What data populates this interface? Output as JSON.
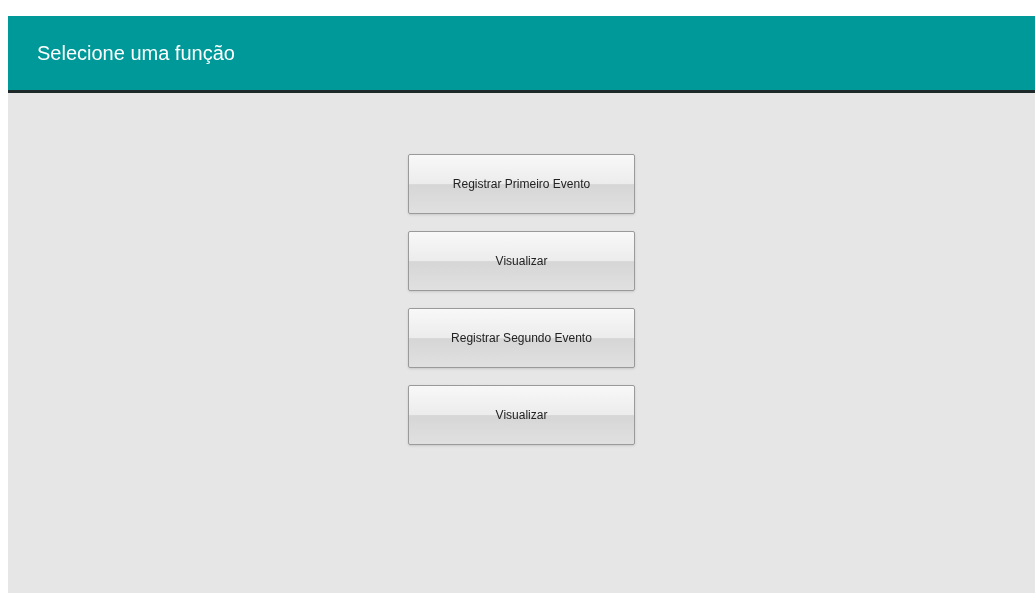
{
  "header": {
    "title": "Selecione uma função"
  },
  "buttons": [
    {
      "label": "Registrar Primeiro Evento"
    },
    {
      "label": "Visualizar"
    },
    {
      "label": "Registrar Segundo Evento"
    },
    {
      "label": "Visualizar"
    }
  ]
}
